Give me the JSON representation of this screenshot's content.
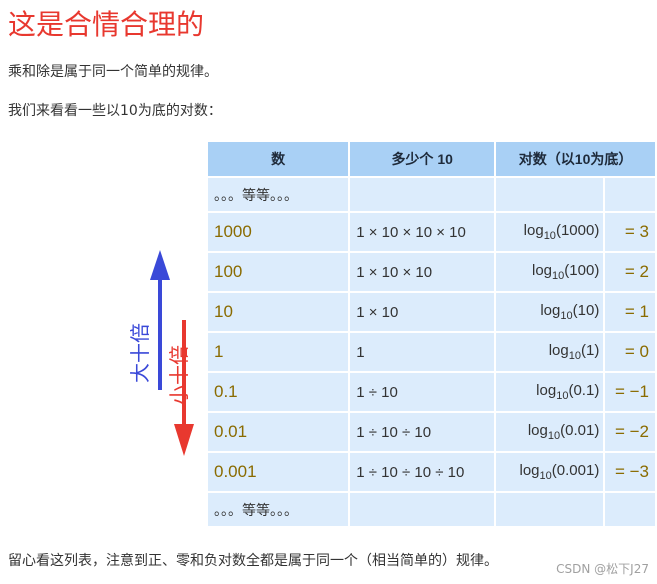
{
  "heading": "这是合情合理的",
  "intro": "乘和除是属于同一个简单的规律。",
  "lead": "我们来看看一些以10为底的对数：",
  "table": {
    "headers": [
      "数",
      "多少个 10",
      "对数（以10为底）"
    ],
    "etc_label": "。。。等等。。。",
    "rows": [
      {
        "number": "1000",
        "expr": "1 × 10 × 10 × 10",
        "log_arg": "1000",
        "result": "3"
      },
      {
        "number": "100",
        "expr": "1 × 10 × 10",
        "log_arg": "100",
        "result": "2"
      },
      {
        "number": "10",
        "expr": "1 × 10",
        "log_arg": "10",
        "result": "1"
      },
      {
        "number": "1",
        "expr": "1",
        "log_arg": "1",
        "result": "0"
      },
      {
        "number": "0.1",
        "expr": "1 ÷ 10",
        "log_arg": "0.1",
        "result": "−1"
      },
      {
        "number": "0.01",
        "expr": "1 ÷ 10 ÷ 10",
        "log_arg": "0.01",
        "result": "−2"
      },
      {
        "number": "0.001",
        "expr": "1 ÷ 10 ÷ 10 ÷ 10",
        "log_arg": "0.001",
        "result": "−3"
      }
    ]
  },
  "arrows": {
    "up_label": "大十倍",
    "down_label": "小十倍",
    "up_color": "#3a49d8",
    "down_color": "#e8382f"
  },
  "footer": "留心看这列表，注意到正、零和负对数全都是属于同一个（相当简单的）规律。",
  "watermark": "CSDN @松下J27"
}
